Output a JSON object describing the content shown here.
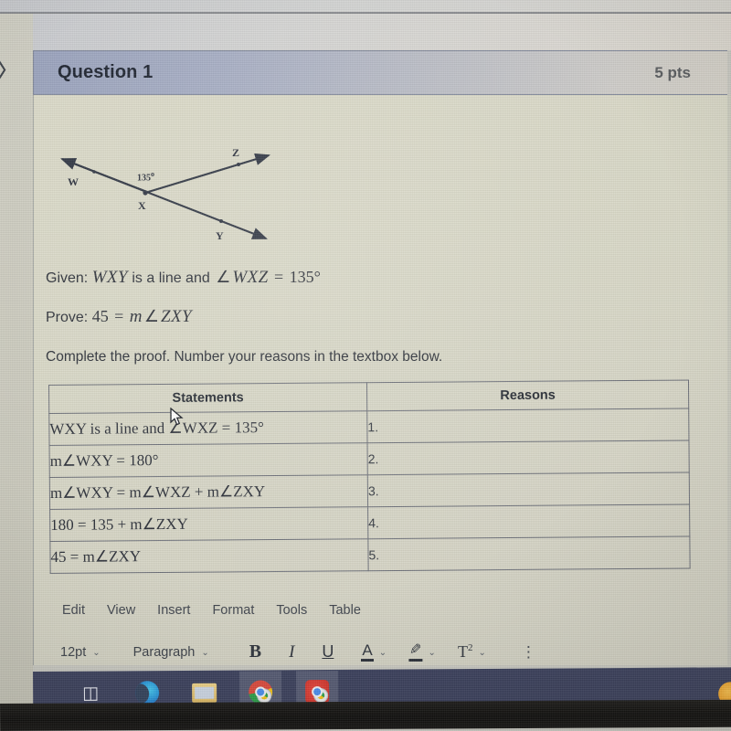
{
  "question": {
    "title": "Question 1",
    "points": "5 pts"
  },
  "figure": {
    "labels": {
      "w": "W",
      "x": "X",
      "y": "Y",
      "z": "Z",
      "angle": "135",
      "degree": "o"
    }
  },
  "given": {
    "prefix": "Given:",
    "segment": "WXY",
    "middle": "is a line and",
    "angle_sym": "∠",
    "angle_name": "WXZ",
    "equals": "=",
    "value": "135°"
  },
  "prove": {
    "prefix": "Prove:",
    "value": "45",
    "equals": "=",
    "expr_m": "m",
    "angle_sym": "∠",
    "angle_name": "ZXY"
  },
  "instruction": "Complete the proof.  Number your reasons in the textbox below.",
  "table": {
    "headers": {
      "statements": "Statements",
      "reasons": "Reasons"
    },
    "rows": [
      {
        "statement": "WXY is a line and ∠WXZ = 135°",
        "reason": "1."
      },
      {
        "statement": "m∠WXY = 180°",
        "reason": "2."
      },
      {
        "statement": "m∠WXY = m∠WXZ + m∠ZXY",
        "reason": "3."
      },
      {
        "statement": "180 = 135 + m∠ZXY",
        "reason": "4."
      },
      {
        "statement": "45 = m∠ZXY",
        "reason": "5."
      }
    ]
  },
  "editor": {
    "menu": [
      "Edit",
      "View",
      "Insert",
      "Format",
      "Tools",
      "Table"
    ],
    "toolbar": {
      "font_size": "12pt",
      "paragraph_style": "Paragraph",
      "bold": "B",
      "italic": "I",
      "underline": "U",
      "text_color": "A",
      "highlight": "✎",
      "superscript": "T",
      "superscript_exp": "2",
      "chevron": "⌄",
      "more": "⋮"
    }
  },
  "taskbar": {
    "apps": [
      "task-view",
      "microsoft-edge",
      "file-explorer",
      "chrome-window-1",
      "chrome-window-2"
    ]
  },
  "edge_glyph": "〉",
  "colors": {
    "header_accent": "#9aa3bd",
    "page_bg": "#d9d7cb",
    "taskbar": "#3a3f5c",
    "text": "#2c3038"
  }
}
